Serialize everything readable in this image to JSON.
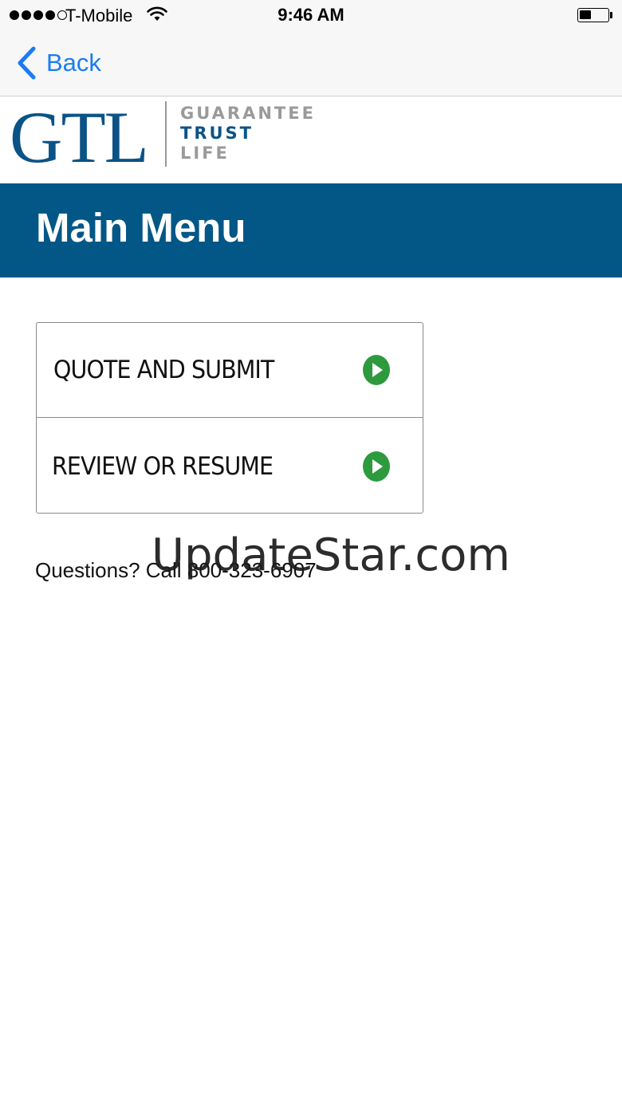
{
  "status_bar": {
    "carrier": "T-Mobile",
    "time": "9:46 AM",
    "signal_bars_filled": 4,
    "signal_bars_total": 5,
    "battery_level_fraction": 0.35
  },
  "nav": {
    "back_label": "Back",
    "back_icon": "chevron-left-icon",
    "accent_color": "#1a7cf2"
  },
  "logo": {
    "mark": "GTL",
    "word1": "GUARANTEE",
    "word2": "TRUST",
    "word3": "LIFE",
    "brand_color": "#0b5387"
  },
  "header": {
    "title": "Main Menu",
    "band_color": "#035787"
  },
  "menu": {
    "items": [
      {
        "label": "QUOTE AND SUBMIT",
        "icon": "play-circle-icon"
      },
      {
        "label": "REVIEW OR RESUME",
        "icon": "play-circle-icon"
      }
    ],
    "icon_color": "#2e9a3e"
  },
  "footer": {
    "questions_text": "Questions? Call 800-323-6907"
  },
  "watermark": {
    "text": "UpdateStar.com"
  }
}
